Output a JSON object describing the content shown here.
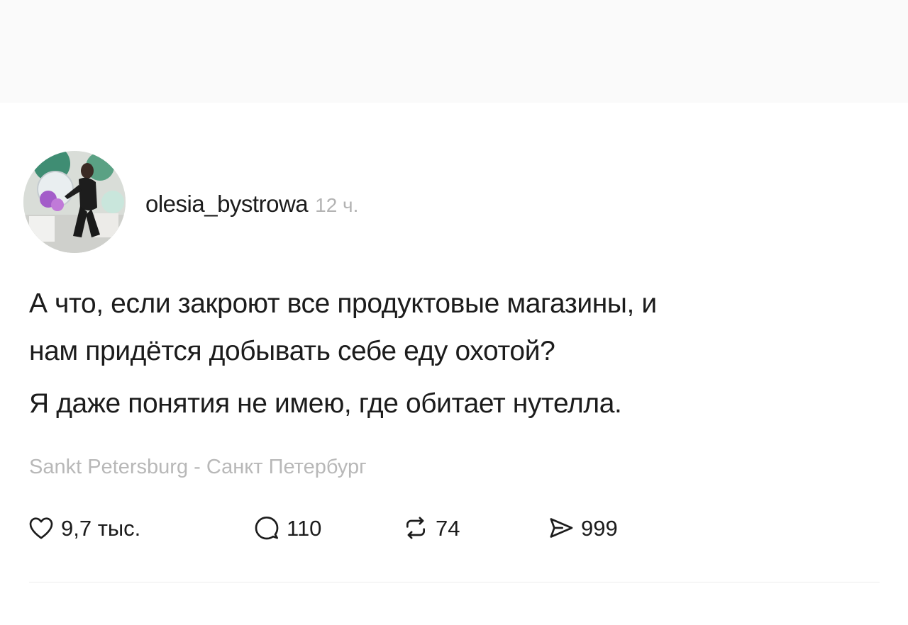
{
  "post": {
    "username": "olesia_bystrowa",
    "time": "12 ч.",
    "text_lines": [
      "А что, если закроют все продуктовые магазины, и",
      "нам придётся добывать себе еду охотой?",
      "Я даже понятия не имею, где обитает нутелла."
    ],
    "location": "Sankt Petersburg - Санкт Петербург"
  },
  "actions": {
    "likes": "9,7 тыс.",
    "replies": "110",
    "reposts": "74",
    "shares": "999"
  },
  "icons": {
    "like": "heart-icon",
    "reply": "comment-bubble-icon",
    "repost": "repost-icon",
    "share": "send-icon"
  },
  "colors": {
    "text": "#1c1c1c",
    "muted": "#b3b3b3",
    "top_band": "#fafafa"
  }
}
